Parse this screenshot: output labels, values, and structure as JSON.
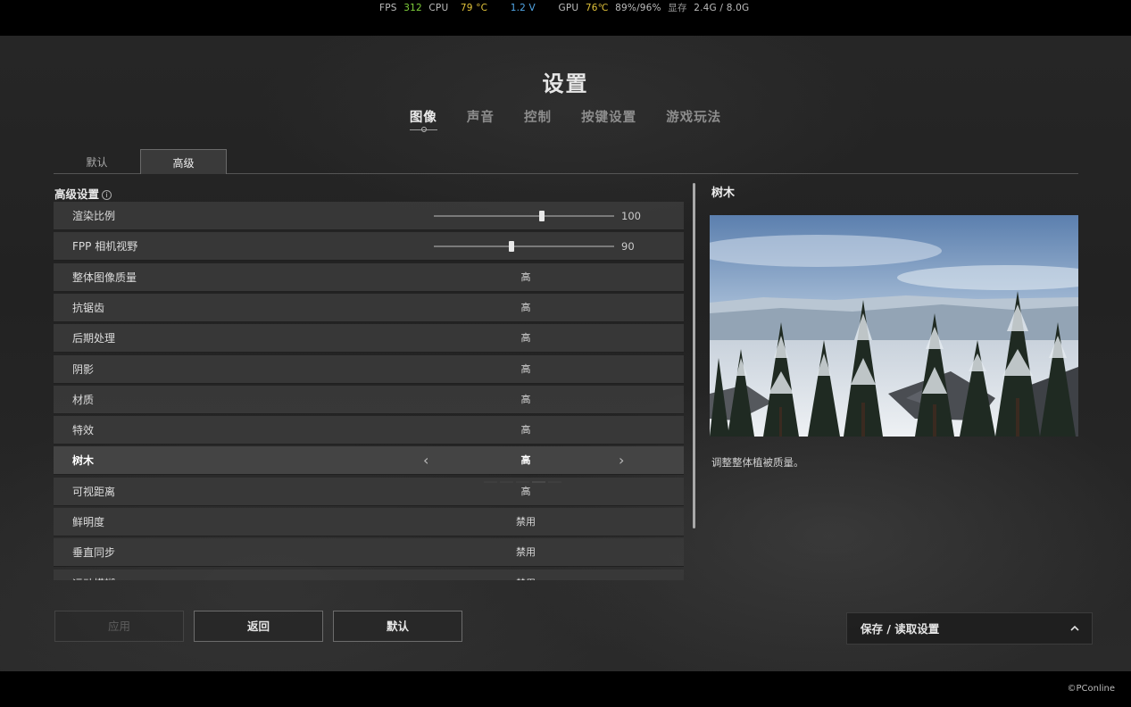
{
  "overlay": {
    "fps_label": "FPS",
    "fps_value": "312",
    "cpu_label": "CPU",
    "cpu_temp": "79 °C",
    "cpu_volt": "1.2 V",
    "gpu_label": "GPU",
    "gpu_temp": "76℃",
    "gpu_usage": "89%/96%",
    "vram_label": "显存",
    "vram_value": "2.4G / 8.0G"
  },
  "page_title": "设置",
  "main_tabs": [
    {
      "label": "图像",
      "active": true
    },
    {
      "label": "声音",
      "active": false
    },
    {
      "label": "控制",
      "active": false
    },
    {
      "label": "按键设置",
      "active": false
    },
    {
      "label": "游戏玩法",
      "active": false
    }
  ],
  "sub_tabs": [
    {
      "label": "默认",
      "active": false
    },
    {
      "label": "高级",
      "active": true
    }
  ],
  "section_title": "高级设置",
  "settings": [
    {
      "name": "渲染比例",
      "type": "slider",
      "value": "100",
      "fraction": 0.6
    },
    {
      "name": "FPP 相机视野",
      "type": "slider",
      "value": "90",
      "fraction": 0.43
    },
    {
      "name": "整体图像质量",
      "type": "option",
      "value": "高"
    },
    {
      "name": "抗锯齿",
      "type": "option",
      "value": "高"
    },
    {
      "name": "后期处理",
      "type": "option",
      "value": "高"
    },
    {
      "name": "阴影",
      "type": "option",
      "value": "高"
    },
    {
      "name": "材质",
      "type": "option",
      "value": "高"
    },
    {
      "name": "特效",
      "type": "option",
      "value": "高"
    },
    {
      "name": "树木",
      "type": "selector",
      "value": "高",
      "selected_step": 4,
      "steps": 5
    },
    {
      "name": "可视距离",
      "type": "option",
      "value": "高"
    },
    {
      "name": "鲜明度",
      "type": "option",
      "value": "禁用"
    },
    {
      "name": "垂直同步",
      "type": "option",
      "value": "禁用"
    },
    {
      "name": "运动模糊",
      "type": "option",
      "value": "禁用"
    }
  ],
  "detail": {
    "title": "树木",
    "description": "调整整体植被质量。"
  },
  "buttons": {
    "apply": "应用",
    "back": "返回",
    "default": "默认"
  },
  "save_load": "保存 / 读取设置",
  "watermark": "©PConline"
}
